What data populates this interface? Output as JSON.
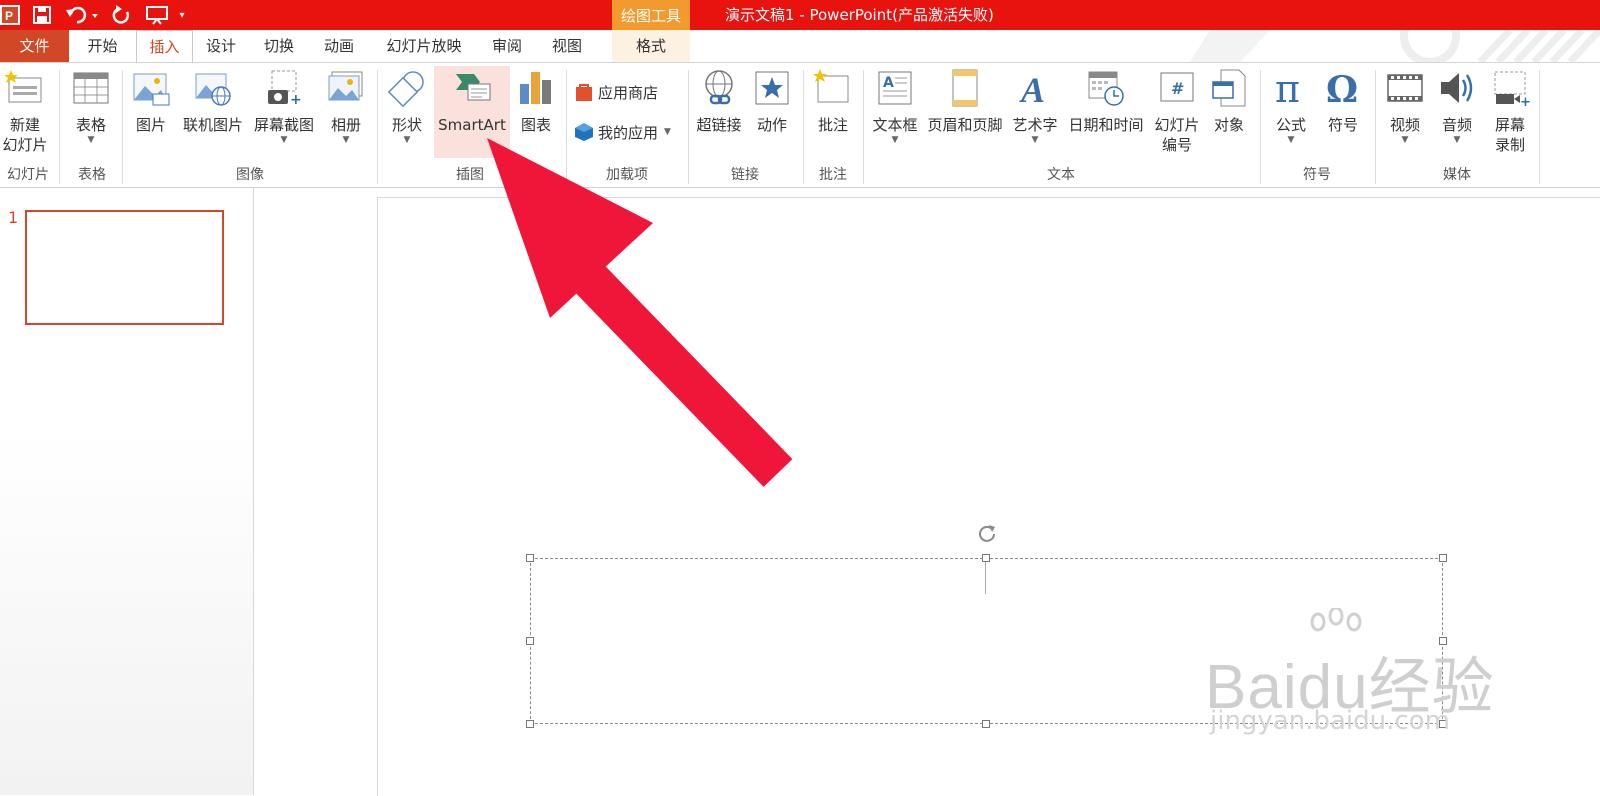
{
  "window": {
    "title": "演示文稿1 - PowerPoint(产品激活失败)",
    "contextual_tab_group": "绘图工具"
  },
  "tabs": [
    "文件",
    "开始",
    "插入",
    "设计",
    "切换",
    "动画",
    "幻灯片放映",
    "审阅",
    "视图",
    "格式"
  ],
  "active_tab": "插入",
  "ribbon": {
    "new_slide": "新建\n幻灯片",
    "table": "表格",
    "picture": "图片",
    "online_picture": "联机图片",
    "screenshot": "屏幕截图",
    "album": "相册",
    "shapes": "形状",
    "smartart": "SmartArt",
    "chart": "图表",
    "app_store": "应用商店",
    "my_apps": "我的应用",
    "hyperlink": "超链接",
    "action": "动作",
    "comment": "批注",
    "textbox": "文本框",
    "header_footer": "页眉和页脚",
    "wordart": "艺术字",
    "datetime": "日期和时间",
    "slide_number": "幻灯片\n编号",
    "object": "对象",
    "equation": "公式",
    "symbol": "符号",
    "video": "视频",
    "audio": "音频",
    "screen_recording": "屏幕\n录制",
    "groups": {
      "slides": "幻灯片",
      "tables": "表格",
      "images": "图像",
      "illustrations": "插图",
      "addins": "加载项",
      "links": "链接",
      "comments": "批注",
      "text": "文本",
      "symbols": "符号",
      "media": "媒体"
    }
  },
  "slides_pane": {
    "slide_number": "1"
  },
  "watermark": {
    "logo": "Baidu经验",
    "url": "jingyan.baidu.com"
  },
  "colors": {
    "title_bar": "#e8120f",
    "file_tab": "#d24726",
    "contextual": "#f29a2e",
    "arrow": "#f0163a"
  }
}
